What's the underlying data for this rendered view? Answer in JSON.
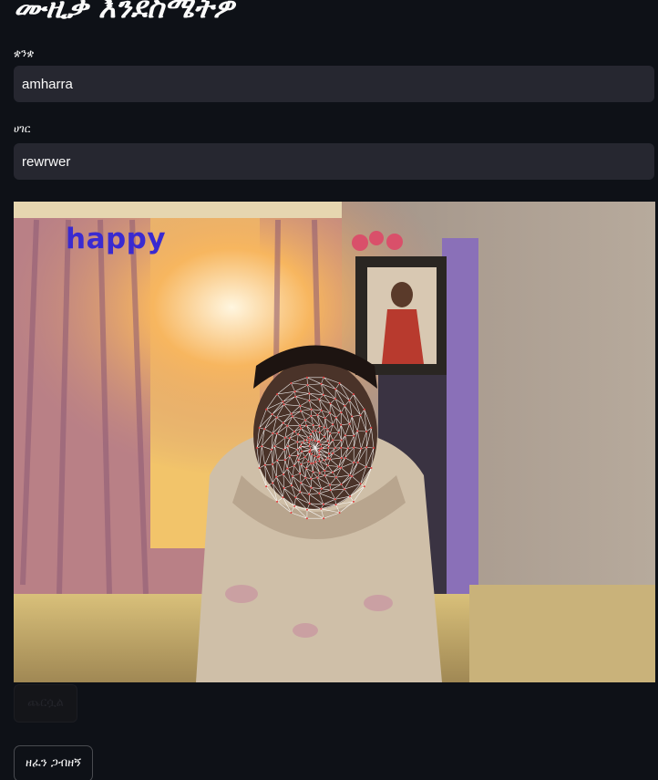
{
  "app": {
    "title": "ሙዚቃ እንደስሜትዎ"
  },
  "form": {
    "language_label": "ቋንቋ",
    "language_value": "amharra",
    "country_label": "ሀገር",
    "country_value": "rewrwer"
  },
  "webcam": {
    "emotion_label": "happy",
    "stop_label": "ጨርሷል"
  },
  "actions": {
    "submit_label": "ዘፈን ጋብዘኝ"
  },
  "colors": {
    "background": "#0e1117",
    "input_background": "#262730",
    "emotion_label": "#3a2ad0",
    "face_mesh": "#ffffff"
  }
}
